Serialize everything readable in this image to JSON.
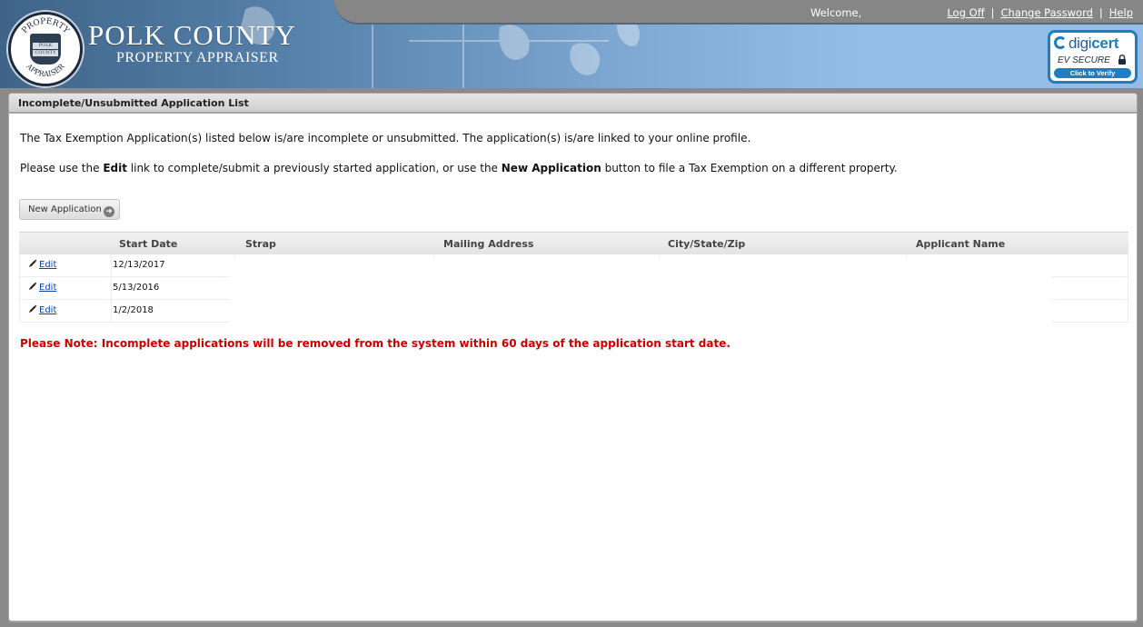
{
  "header": {
    "brand_title": "POLK COUNTY",
    "brand_subtitle": "PROPERTY APPRAISER",
    "seal_top": "PROPERTY",
    "seal_bottom": "APPRAISER",
    "seal_center_1": "POLK",
    "seal_center_2": "COUNTY",
    "welcome": "Welcome,",
    "links": {
      "log_off": "Log Off",
      "change_password": "Change Password",
      "help": "Help",
      "separator": "|"
    },
    "badge": {
      "brand_light": "digi",
      "brand_bold": "cert",
      "line": "EV SECURE",
      "verify": "Click to Verify"
    }
  },
  "panel": {
    "title": "Incomplete/Unsubmitted Application List",
    "intro": "The Tax Exemption Application(s) listed below is/are incomplete or unsubmitted. The application(s) is/are linked to your online profile.",
    "instructions": {
      "part1": "Please use the ",
      "edit_bold": "Edit",
      "part2": " link to complete/submit a previously started application, or use the ",
      "new_bold": "New Application",
      "part3": " button to file a Tax Exemption on a different property."
    },
    "new_application_button": "New Application",
    "table": {
      "columns": [
        "",
        "Start Date",
        "Strap",
        "Mailing Address",
        "City/State/Zip",
        "Applicant Name"
      ],
      "rows": [
        {
          "action": "Edit",
          "start_date": "12/13/2017",
          "strap": "",
          "mailing_address": "",
          "city_state_zip": "",
          "applicant_name": ""
        },
        {
          "action": "Edit",
          "start_date": "5/13/2016",
          "strap": "",
          "mailing_address": "",
          "city_state_zip": "",
          "applicant_name": ""
        },
        {
          "action": "Edit",
          "start_date": "1/2/2018",
          "strap": "",
          "mailing_address": "",
          "city_state_zip": "",
          "applicant_name": ""
        }
      ]
    },
    "note": "Please Note: Incomplete applications will be removed from the system within 60 days of the application start date."
  },
  "colors": {
    "note_red": "#cc0000",
    "link_blue": "#0645ad",
    "topbar_gray": "#868686",
    "header_blue": "#93bde6",
    "digicert_blue": "#1f7dc1"
  }
}
